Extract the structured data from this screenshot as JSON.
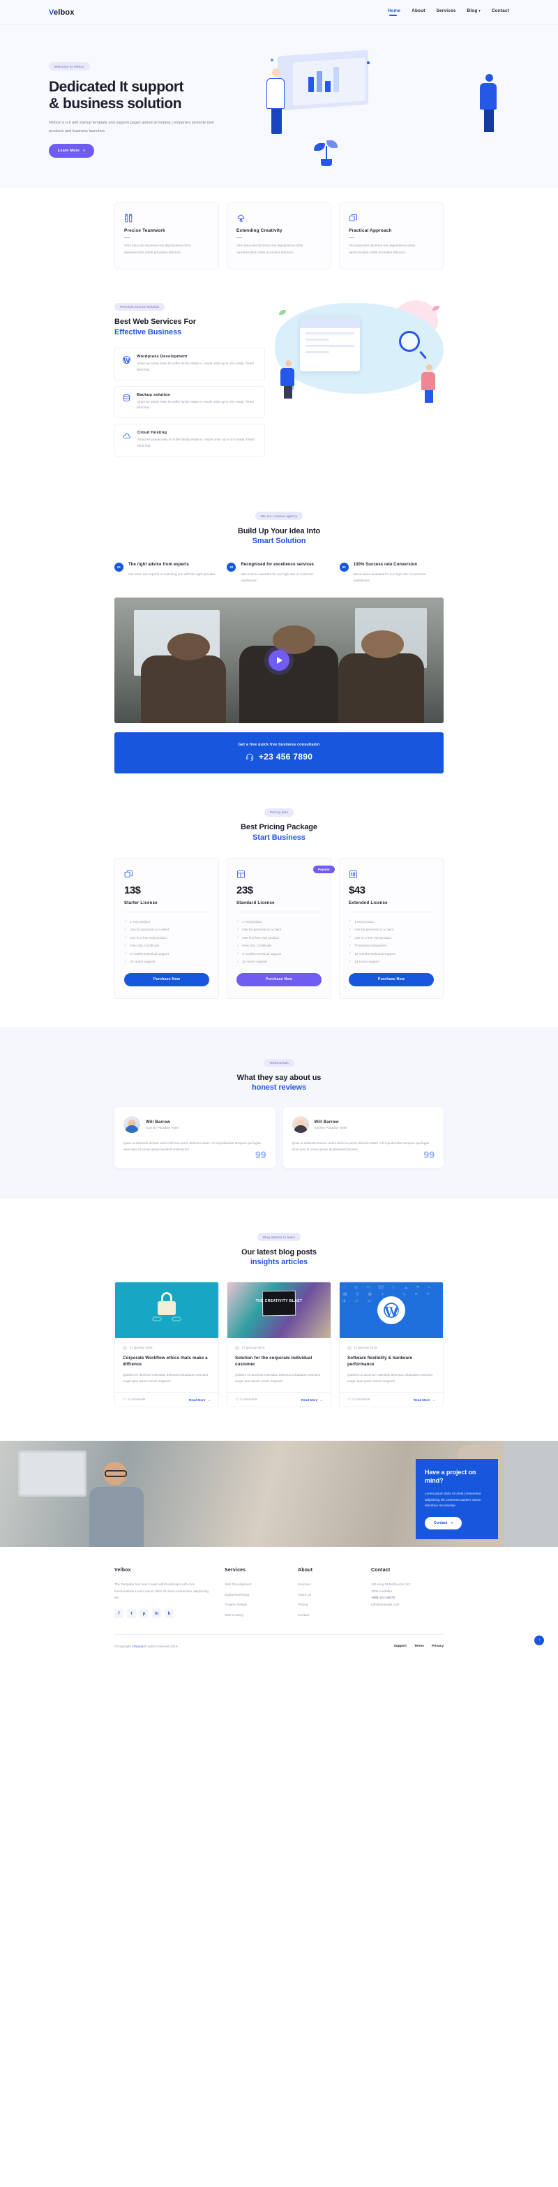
{
  "brand": {
    "name": "Velbox",
    "first_letter": "V",
    "rest": "elbox"
  },
  "nav": {
    "items": [
      {
        "label": "Home",
        "active": true
      },
      {
        "label": "About",
        "active": false
      },
      {
        "label": "Services",
        "active": false
      },
      {
        "label": "Blog",
        "active": false,
        "has_dropdown": true
      },
      {
        "label": "Contact",
        "active": false
      }
    ]
  },
  "hero": {
    "pill": "Welcome to Velbox",
    "title_line1": "Dedicated It support",
    "title_line2": "& business solution",
    "paragraph": "Velbox is a it and startup template and support pages aimed at helping companies promote new products and business launches.",
    "cta_label": "Learn More",
    "cta_icon": "chevrons-right-icon"
  },
  "features": {
    "cards": [
      {
        "icon": "ruler-pencil-icon",
        "title": "Precise Teamwork",
        "text": "Vero ipsa,sint ducimus non dignissimos,dicta reprehenderit nobis provident laborum."
      },
      {
        "icon": "cloud-search-icon",
        "title": "Extending Creativity",
        "text": "Vero ipsa,sint ducimus non dignissimos,dicta reprehenderit nobis provident laborum."
      },
      {
        "icon": "layers-icon",
        "title": "Practical Approach",
        "text": "Vero ipsa,sint ducimus non dignissimos,dicta reprehenderit nobis provident laborum."
      }
    ]
  },
  "services": {
    "pill": "Premium service solution",
    "title_line1": "Best Web Services For",
    "title_line2": "Effective Business",
    "items": [
      {
        "icon": "wordpress-icon",
        "title": "Wordpress Development",
        "text": "Afraid we praise lively he suffer family estate is. Ample order up in of in ready. Timed blind had ."
      },
      {
        "icon": "database-icon",
        "title": "Backup solution",
        "text": "Afraid we praise lively he suffer family estate is. Ample order up in of in ready. Timed blind had ."
      },
      {
        "icon": "cloud-icon",
        "title": "Cloud Hosting",
        "text": "Afraid we praise lively he suffer family estate is. Ample order up in of in ready. Timed blind had ."
      }
    ]
  },
  "smart": {
    "pill": "We are creative agency",
    "title_line1": "Build Up Your Idea Into",
    "title_line2": "Smart Solution",
    "steps": [
      {
        "num": "01",
        "title": "The right advice from experts",
        "text": "Our team are experts in matching you with the right provider."
      },
      {
        "num": "02",
        "title": "Recognised for excellence services",
        "text": "We've been awarded for our high rate of customer satisfaction."
      },
      {
        "num": "03",
        "title": "100% Success rate Conversion",
        "text": "We've been awarded for our high rate of customer satisfaction."
      }
    ],
    "video_play_label": "play-button"
  },
  "cta_bar": {
    "text": "Get a free quick free business consultaion",
    "phone": "+23 456 7890",
    "icon": "headset-icon"
  },
  "pricing": {
    "pill": "Pricing plan",
    "title_line1": "Best Pricing Package",
    "title_line2": "Start Business",
    "popular_badge": "Popular",
    "plans": [
      {
        "icon": "layers-icon",
        "price": "13$",
        "name": "Starter License",
        "popular": false,
        "features": [
          "1 end product",
          "Use for personal or a client",
          "Use in a free end product",
          "Free SSL Certificate",
          "6 months technical support",
          "24 Hours support"
        ],
        "button": "Purchase Now"
      },
      {
        "icon": "layout-icon",
        "price": "23$",
        "name": "Standard License",
        "popular": true,
        "features": [
          "1 end product",
          "Use for personal or a client",
          "Use in a free end product",
          "Free SSL Certificate",
          "6 months technical support",
          "24 Hours support"
        ],
        "button": "Purchase Now"
      },
      {
        "icon": "sliders-icon",
        "price": "$43",
        "name": "Extended License",
        "popular": false,
        "features": [
          "1 end product",
          "Use for personal or a client",
          "Use in a free end product",
          "Third-party integration",
          "12 months technical support",
          "24 Hours support"
        ],
        "button": "Purchase Now"
      }
    ]
  },
  "testimonials": {
    "pill": "Testimonials",
    "title_line1": "What they say about us",
    "title_line2": "honest reviews",
    "quote_mark": "99",
    "cards": [
      {
        "name": "Will Barrow",
        "role": "Sunrise Paradise Hotel",
        "text": "Quas ut distinctio tenetur animi nihil rem,amet dolorum totam. Ab repudiandae tempore qui fugiat amet ipsa id omnis ipsam,laudantium!Dolorem."
      },
      {
        "name": "Will Barrow",
        "role": "Sunrise Paradise Hotel",
        "text": "Quas ut distinctio tenetur animi nihil rem,amet dolorum totam. Ab repudiandae tempore qui fugiat amet ipsa id omnis ipsam,laudantium!Dolorem."
      }
    ]
  },
  "blog": {
    "pill": "Blog articles to learn",
    "title_line1": "Our latest blog posts",
    "title_line2": "insights articles",
    "posts": [
      {
        "date": "17 januray 2019",
        "title": "Corporate Workflow ethics thats make a diffrence",
        "excerpt": "Quidem ex ducimus molestiae delectus,voluptatum nesciunt magni ipsa ipsam omnis magnam.",
        "comments": "2 comments",
        "readmore": "Read More"
      },
      {
        "date": "17 januray 2019",
        "title": "Solution for the corporate individual customer",
        "excerpt": "Quidem ex ducimus molestiae delectus,voluptatum nesciunt magni ipsa ipsam omnis magnam.",
        "comments": "2 comments",
        "readmore": "Read More"
      },
      {
        "date": "17 januray 2019",
        "title": "Software flexibility & hardware performance",
        "excerpt": "Quidem ex ducimus molestiae delectus,voluptatum nesciunt magni ipsa ipsam omnis magnam.",
        "comments": "2 comments",
        "readmore": "Read More"
      }
    ],
    "thumb2_text": "THE CREATIVITY BLAST"
  },
  "project": {
    "title": "Have a project on mind?",
    "text": "Lorem ipsum dolor sit amet,consectetur adipisicing elit. Deserunt quidem earum doloribus recusandae",
    "button": "Contact"
  },
  "footer": {
    "brand": "Velbox",
    "about": "The Template has been made with bootstrap4 with core functionalises.Lorem ipsum dolor sit amet,consectetur adipisicing elit.",
    "socials": [
      "f",
      "t",
      "p",
      "in",
      "b"
    ],
    "services_title": "Services",
    "services": [
      "Web Development",
      "Digital Marketing",
      "Graphic Design",
      "Web Hosting"
    ],
    "about_title": "About",
    "about_links": [
      "Services",
      "About Us",
      "Pricing",
      "Contact"
    ],
    "contact_title": "Contact",
    "address_line1": "121 King St,Melbourne VIC",
    "address_line2": "3000,Australia",
    "phone": "+888 123 45678",
    "email": "Info@example.com",
    "copyright_pre": "©Copyright ",
    "copyright_link": "17sucai",
    "copyright_post": "All rights reserved-2019.",
    "bottom_links": [
      "Support",
      "Terms",
      "Privacy"
    ],
    "scroll_top_icon": "arrow-up-icon"
  },
  "colors": {
    "blue": "#1657dd",
    "purple": "#6f5cf0",
    "accent_text": "#2558e6",
    "muted": "#9a9aae",
    "light_bg": "#f8f9fe"
  }
}
